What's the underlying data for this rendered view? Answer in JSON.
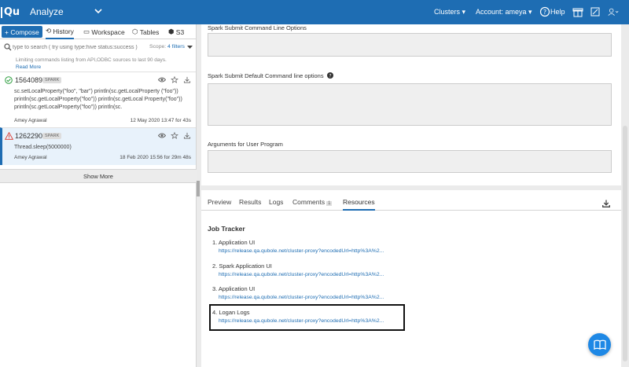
{
  "header": {
    "logo": "Qu",
    "app_title": "Analyze",
    "clusters": "Clusters",
    "account": "Account: ameya",
    "help": "Help"
  },
  "left": {
    "compose": "Compose",
    "tabs": [
      "History",
      "Workspace",
      "Tables",
      "S3"
    ],
    "search_placeholder": "type to search ( try using type:hive status:success )",
    "scope_label": "Scope:",
    "scope_value": "4 filters",
    "notice": "Limiting commands listing from API,ODBC sources to last 90 days.",
    "read_more": "Read More",
    "commands": [
      {
        "id": "1564089",
        "badge": "SPARK",
        "status": "success",
        "body": "sc.setLocalProperty(\"foo\", \"bar\") println(sc.getLocalProperty (\"foo\")) println(sc.getLocalProperty(\"foo\")) println(sc.getLocal Property(\"foo\")) println(sc.getLocalProperty(\"foo\")) println(sc.",
        "user": "Amey Agrawal",
        "time": "12 May 2020 13:47 for 43s"
      },
      {
        "id": "1262290",
        "badge": "SPARK",
        "status": "error",
        "body": "Thread.sleep(5000000)",
        "user": "Amey Agrawal",
        "time": "18 Feb 2020 15:56 for 29m 48s"
      }
    ],
    "show_more": "Show More"
  },
  "right": {
    "fields": [
      "Spark Submit Command Line Options",
      "Spark Submit Default Command line options",
      "Arguments for User Program"
    ],
    "tabs": [
      "Preview",
      "Results",
      "Logs",
      "Comments",
      "Resources"
    ],
    "comments_count": "1",
    "job_tracker_title": "Job Tracker",
    "jobs": [
      {
        "name": "1. Application UI",
        "link": "https://release.qa.qubole.net/cluster-proxy?encodedUrl=http%3A%2..."
      },
      {
        "name": "2. Spark Application UI",
        "link": "https://release.qa.qubole.net/cluster-proxy?encodedUrl=http%3A%2..."
      },
      {
        "name": "3. Application UI",
        "link": "https://release.qa.qubole.net/cluster-proxy?encodedUrl=http%3A%2..."
      },
      {
        "name": "4. Logan Logs",
        "link": "https://release.qa.qubole.net/cluster-proxy?encodedUrl=http%3A%2..."
      }
    ]
  },
  "colors": {
    "brand": "#1e6db3",
    "link": "#1e6db3",
    "success": "#2e9e3f",
    "error": "#d9342b"
  }
}
